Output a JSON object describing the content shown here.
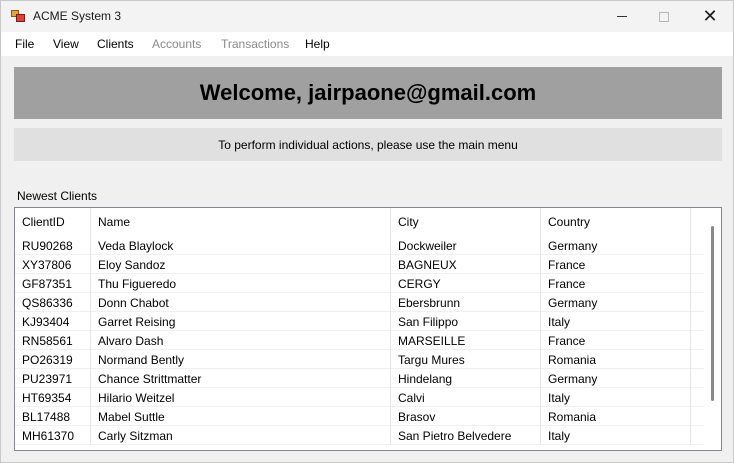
{
  "window": {
    "title": "ACME System 3"
  },
  "menu": {
    "file": "File",
    "view": "View",
    "clients": "Clients",
    "accounts": "Accounts",
    "transactions": "Transactions",
    "help": "Help"
  },
  "welcome": "Welcome, jairpaone@gmail.com",
  "info": "To perform individual actions, please use the main menu",
  "section_label": "Newest Clients",
  "table": {
    "columns": [
      "ClientID",
      "Name",
      "City",
      "Country"
    ],
    "rows": [
      [
        "RU90268",
        "Veda Blaylock",
        "Dockweiler",
        "Germany"
      ],
      [
        "XY37806",
        "Eloy Sandoz",
        "BAGNEUX",
        "France"
      ],
      [
        "GF87351",
        "Thu Figueredo",
        "CERGY",
        "France"
      ],
      [
        "QS86336",
        "Donn Chabot",
        "Ebersbrunn",
        "Germany"
      ],
      [
        "KJ93404",
        "Garret Reising",
        "San Filippo",
        "Italy"
      ],
      [
        "RN58561",
        "Alvaro Dash",
        "MARSEILLE",
        "France"
      ],
      [
        "PO26319",
        "Normand Bently",
        "Targu Mures",
        "Romania"
      ],
      [
        "PU23971",
        "Chance Strittmatter",
        "Hindelang",
        "Germany"
      ],
      [
        "HT69354",
        "Hilario Weitzel",
        "Calvi",
        "Italy"
      ],
      [
        "BL17488",
        "Mabel Suttle",
        "Brasov",
        "Romania"
      ],
      [
        "MH61370",
        "Carly Sitzman",
        "San Pietro Belvedere",
        "Italy"
      ]
    ]
  }
}
